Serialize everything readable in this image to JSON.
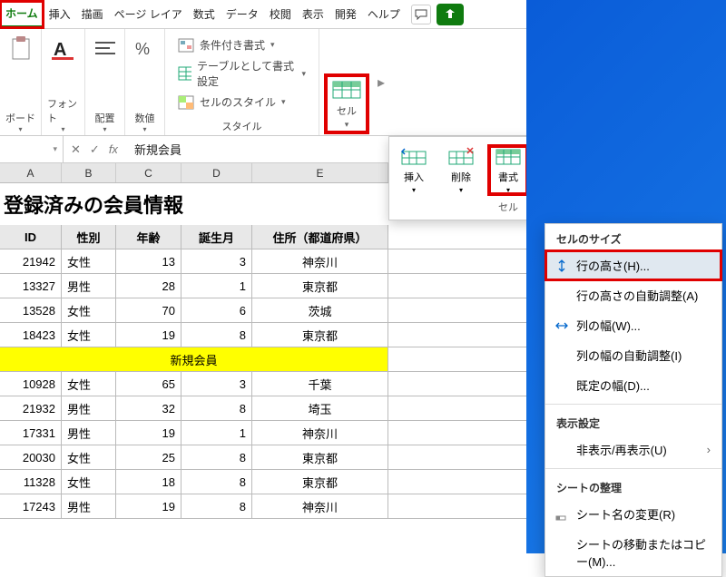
{
  "tabs": {
    "home": "ホーム",
    "insert": "挿入",
    "draw": "描画",
    "pagelayout": "ページ レイア",
    "formulas": "数式",
    "data": "データ",
    "review": "校閲",
    "view": "表示",
    "developer": "開発",
    "help": "ヘルプ"
  },
  "ribbon": {
    "clipboard": "ボード",
    "font": "フォント",
    "alignment": "配置",
    "number": "数値",
    "cond_format": "条件付き書式",
    "table_format": "テーブルとして書式設定",
    "cell_styles": "セルのスタイル",
    "styles_label": "スタイル",
    "cells": "セル"
  },
  "formula_bar": {
    "fx": "fx",
    "value": "新規会員"
  },
  "columns": [
    "A",
    "B",
    "C",
    "D",
    "E"
  ],
  "sheet": {
    "title": "登録済みの会員情報",
    "headers": [
      "ID",
      "性別",
      "年齢",
      "誕生月",
      "住所（都道府県）"
    ],
    "rows": [
      [
        "21942",
        "女性",
        "13",
        "3",
        "神奈川"
      ],
      [
        "13327",
        "男性",
        "28",
        "1",
        "東京都"
      ],
      [
        "13528",
        "女性",
        "70",
        "6",
        "茨城"
      ],
      [
        "18423",
        "女性",
        "19",
        "8",
        "東京都"
      ]
    ],
    "new_member": "新規会員",
    "rows2": [
      [
        "10928",
        "女性",
        "65",
        "3",
        "千葉"
      ],
      [
        "21932",
        "男性",
        "32",
        "8",
        "埼玉"
      ],
      [
        "17331",
        "男性",
        "19",
        "1",
        "神奈川"
      ],
      [
        "20030",
        "女性",
        "25",
        "8",
        "東京都"
      ],
      [
        "11328",
        "女性",
        "18",
        "8",
        "東京都"
      ],
      [
        "17243",
        "男性",
        "19",
        "8",
        "神奈川"
      ]
    ]
  },
  "cellpanel": {
    "insert": "挿入",
    "delete": "削除",
    "format": "書式",
    "group": "セル"
  },
  "fmtmenu": {
    "cell_size": "セルのサイズ",
    "row_height": "行の高さ(H)...",
    "autofit_row": "行の高さの自動調整(A)",
    "col_width": "列の幅(W)...",
    "autofit_col": "列の幅の自動調整(I)",
    "default_width": "既定の幅(D)...",
    "visibility": "表示設定",
    "hide_unhide": "非表示/再表示(U)",
    "organize": "シートの整理",
    "rename": "シート名の変更(R)",
    "move_copy": "シートの移動またはコピー(M)..."
  }
}
